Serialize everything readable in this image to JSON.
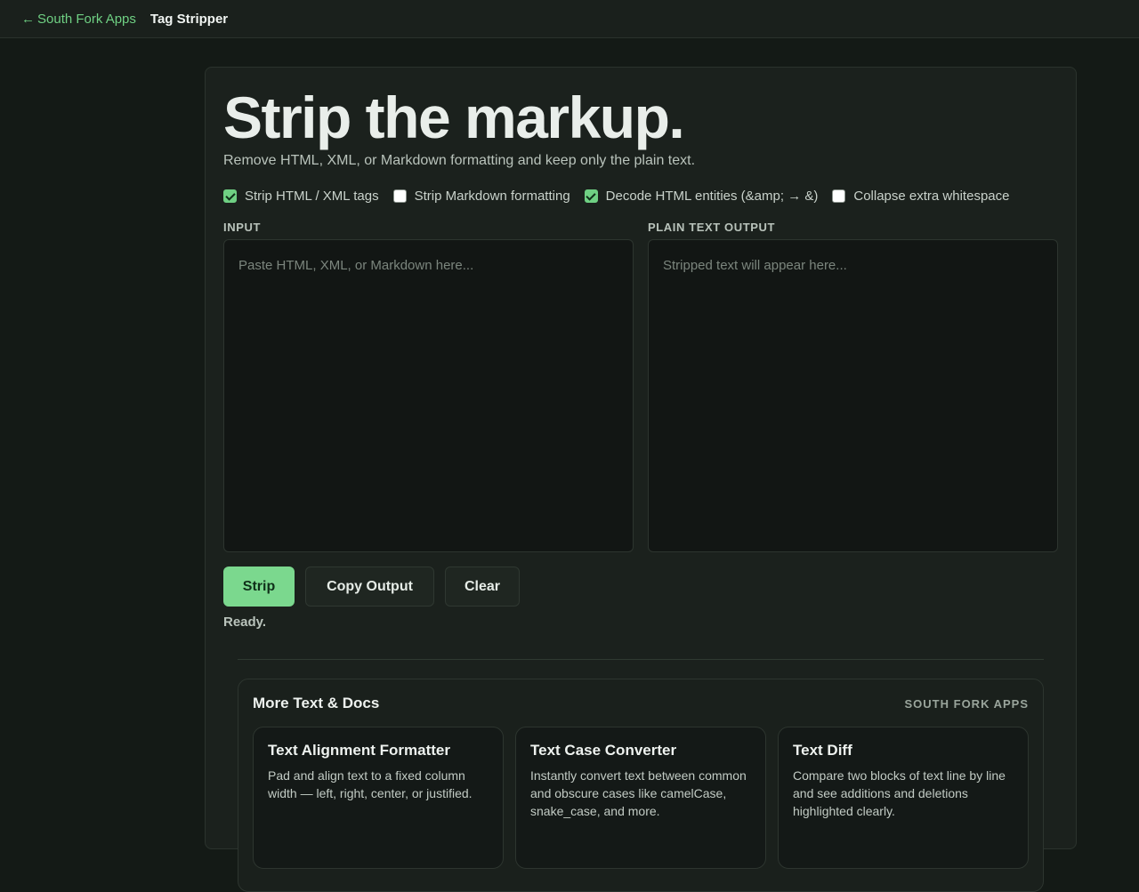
{
  "topbar": {
    "back_arrow": "←",
    "back_label": "South Fork Apps",
    "app_name": "Tag Stripper"
  },
  "hero": {
    "title": "Strip the markup.",
    "subtitle": "Remove HTML, XML, or Markdown formatting and keep only the plain text."
  },
  "options": [
    {
      "label": "Strip HTML / XML tags",
      "checked": true
    },
    {
      "label": "Strip Markdown formatting",
      "checked": false
    },
    {
      "label": "Decode HTML entities (&amp; → &)",
      "checked": true
    },
    {
      "label": "Collapse extra whitespace",
      "checked": false
    }
  ],
  "input": {
    "label": "INPUT",
    "value": "",
    "placeholder": "Paste HTML, XML, or Markdown here..."
  },
  "output": {
    "label": "PLAIN TEXT OUTPUT",
    "value": "",
    "placeholder": "Stripped text will appear here..."
  },
  "actions": {
    "strip_label": "Strip",
    "copy_label": "Copy Output",
    "clear_label": "Clear"
  },
  "status": "Ready.",
  "more": {
    "title": "More Text & Docs",
    "brand": "SOUTH FORK APPS",
    "tools": [
      {
        "name": "Text Alignment Formatter",
        "desc": "Pad and align text to a fixed column width — left, right, center, or justified."
      },
      {
        "name": "Text Case Converter",
        "desc": "Instantly convert text between common and obscure cases like camelCase, snake_case, and more."
      },
      {
        "name": "Text Diff",
        "desc": "Compare two blocks of text line by line and see additions and deletions highlighted clearly."
      }
    ]
  },
  "colors": {
    "accent": "#6fd083",
    "background": "#141a16",
    "card": "#1b211d"
  }
}
